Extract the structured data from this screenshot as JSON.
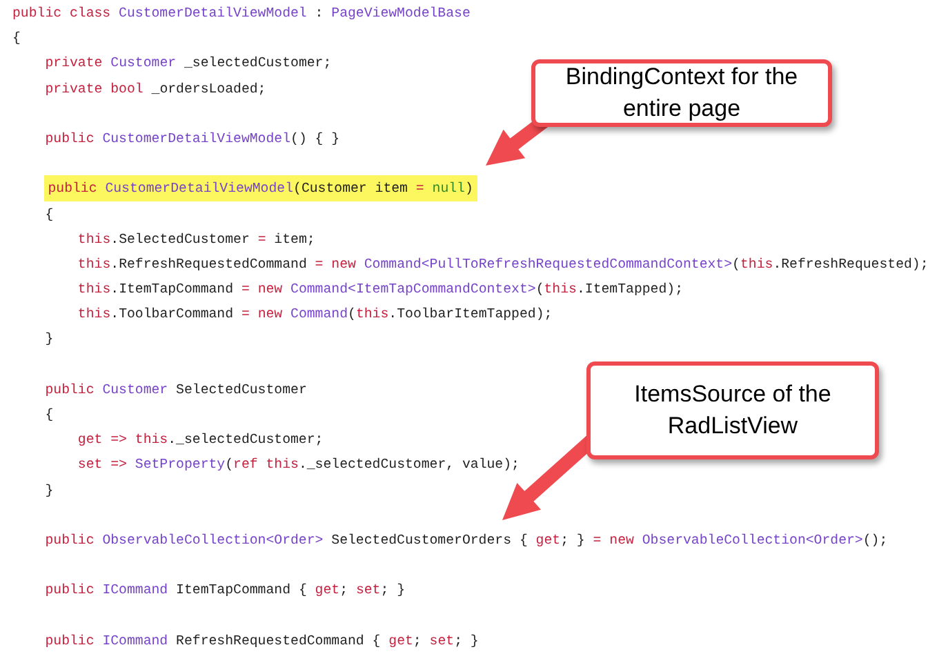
{
  "code_lines": [
    {
      "kind": "top",
      "tokens": [
        {
          "text": "public class ",
          "kind": "keyword"
        },
        {
          "text": "CustomerDetailViewModel",
          "kind": "type"
        },
        {
          "text": " : ",
          "kind": "plain"
        },
        {
          "text": "PageViewModelBase",
          "kind": "type"
        }
      ]
    },
    {
      "kind": "top",
      "tokens": [
        {
          "text": "{",
          "kind": "plain"
        }
      ]
    },
    {
      "kind": "member",
      "tokens": [
        {
          "text": "private ",
          "kind": "keyword"
        },
        {
          "text": "Customer",
          "kind": "type"
        },
        {
          "text": " _selectedCustomer;",
          "kind": "plain"
        }
      ]
    },
    {
      "kind": "member",
      "tokens": [
        {
          "text": "private bool",
          "kind": "keyword"
        },
        {
          "text": " _ordersLoaded;",
          "kind": "plain"
        }
      ]
    },
    {
      "kind": "blank"
    },
    {
      "kind": "member",
      "tokens": [
        {
          "text": "public ",
          "kind": "keyword"
        },
        {
          "text": "CustomerDetailViewModel",
          "kind": "type"
        },
        {
          "text": "() { }",
          "kind": "plain"
        }
      ]
    },
    {
      "kind": "blank"
    },
    {
      "kind": "member",
      "highlighted": true,
      "tokens": [
        {
          "text": "public ",
          "kind": "keyword"
        },
        {
          "text": "CustomerDetailViewModel",
          "kind": "type"
        },
        {
          "text": "(Customer item ",
          "kind": "plain"
        },
        {
          "text": "= ",
          "kind": "keyword"
        },
        {
          "text": "null",
          "kind": "literal"
        },
        {
          "text": ")",
          "kind": "plain"
        }
      ]
    },
    {
      "kind": "member",
      "tokens": [
        {
          "text": "{",
          "kind": "plain"
        }
      ]
    },
    {
      "kind": "statement",
      "tokens": [
        {
          "text": "this",
          "kind": "keyword"
        },
        {
          "text": ".SelectedCustomer ",
          "kind": "plain"
        },
        {
          "text": "=",
          "kind": "keyword"
        },
        {
          "text": " item;",
          "kind": "plain"
        }
      ]
    },
    {
      "kind": "statement",
      "tokens": [
        {
          "text": "this",
          "kind": "keyword"
        },
        {
          "text": ".RefreshRequestedCommand ",
          "kind": "plain"
        },
        {
          "text": "= new ",
          "kind": "keyword"
        },
        {
          "text": "Command<PullToRefreshRequestedCommandContext>",
          "kind": "type"
        },
        {
          "text": "(",
          "kind": "plain"
        },
        {
          "text": "this",
          "kind": "keyword"
        },
        {
          "text": ".RefreshRequested);",
          "kind": "plain"
        }
      ]
    },
    {
      "kind": "statement",
      "tokens": [
        {
          "text": "this",
          "kind": "keyword"
        },
        {
          "text": ".ItemTapCommand ",
          "kind": "plain"
        },
        {
          "text": "= new ",
          "kind": "keyword"
        },
        {
          "text": "Command<ItemTapCommandContext>",
          "kind": "type"
        },
        {
          "text": "(",
          "kind": "plain"
        },
        {
          "text": "this",
          "kind": "keyword"
        },
        {
          "text": ".ItemTapped);",
          "kind": "plain"
        }
      ]
    },
    {
      "kind": "statement",
      "tokens": [
        {
          "text": "this",
          "kind": "keyword"
        },
        {
          "text": ".ToolbarCommand ",
          "kind": "plain"
        },
        {
          "text": "= new ",
          "kind": "keyword"
        },
        {
          "text": "Command",
          "kind": "type"
        },
        {
          "text": "(",
          "kind": "plain"
        },
        {
          "text": "this",
          "kind": "keyword"
        },
        {
          "text": ".ToolbarItemTapped);",
          "kind": "plain"
        }
      ]
    },
    {
      "kind": "member",
      "tokens": [
        {
          "text": "}",
          "kind": "plain"
        }
      ]
    },
    {
      "kind": "blank"
    },
    {
      "kind": "member",
      "tokens": [
        {
          "text": "public ",
          "kind": "keyword"
        },
        {
          "text": "Customer",
          "kind": "type"
        },
        {
          "text": " SelectedCustomer",
          "kind": "plain"
        }
      ]
    },
    {
      "kind": "member",
      "tokens": [
        {
          "text": "{",
          "kind": "plain"
        }
      ]
    },
    {
      "kind": "statement",
      "tokens": [
        {
          "text": "get => this",
          "kind": "keyword"
        },
        {
          "text": "._selectedCustomer;",
          "kind": "plain"
        }
      ]
    },
    {
      "kind": "statement",
      "tokens": [
        {
          "text": "set => ",
          "kind": "keyword"
        },
        {
          "text": "SetProperty",
          "kind": "type"
        },
        {
          "text": "(",
          "kind": "plain"
        },
        {
          "text": "ref this",
          "kind": "keyword"
        },
        {
          "text": "._selectedCustomer, value);",
          "kind": "plain"
        }
      ]
    },
    {
      "kind": "member",
      "tokens": [
        {
          "text": "}",
          "kind": "plain"
        }
      ]
    },
    {
      "kind": "blank"
    },
    {
      "kind": "member",
      "tokens": [
        {
          "text": "public ",
          "kind": "keyword"
        },
        {
          "text": "ObservableCollection<Order>",
          "kind": "type"
        },
        {
          "text": " SelectedCustomerOrders { ",
          "kind": "plain"
        },
        {
          "text": "get",
          "kind": "keyword"
        },
        {
          "text": "; } ",
          "kind": "plain"
        },
        {
          "text": "= new ",
          "kind": "keyword"
        },
        {
          "text": "ObservableCollection<Order>",
          "kind": "type"
        },
        {
          "text": "();",
          "kind": "plain"
        }
      ]
    },
    {
      "kind": "blank"
    },
    {
      "kind": "member",
      "tokens": [
        {
          "text": "public ",
          "kind": "keyword"
        },
        {
          "text": "ICommand",
          "kind": "type"
        },
        {
          "text": " ItemTapCommand { ",
          "kind": "plain"
        },
        {
          "text": "get",
          "kind": "keyword"
        },
        {
          "text": "; ",
          "kind": "plain"
        },
        {
          "text": "set",
          "kind": "keyword"
        },
        {
          "text": "; }",
          "kind": "plain"
        }
      ]
    },
    {
      "kind": "blank"
    },
    {
      "kind": "member",
      "tokens": [
        {
          "text": "public ",
          "kind": "keyword"
        },
        {
          "text": "ICommand",
          "kind": "type"
        },
        {
          "text": " RefreshRequestedCommand { ",
          "kind": "plain"
        },
        {
          "text": "get",
          "kind": "keyword"
        },
        {
          "text": "; ",
          "kind": "plain"
        },
        {
          "text": "set",
          "kind": "keyword"
        },
        {
          "text": "; }",
          "kind": "plain"
        }
      ]
    }
  ],
  "callouts": [
    {
      "text": "BindingContext for the entire page"
    },
    {
      "text": "ItemsSource of the RadListView"
    }
  ]
}
